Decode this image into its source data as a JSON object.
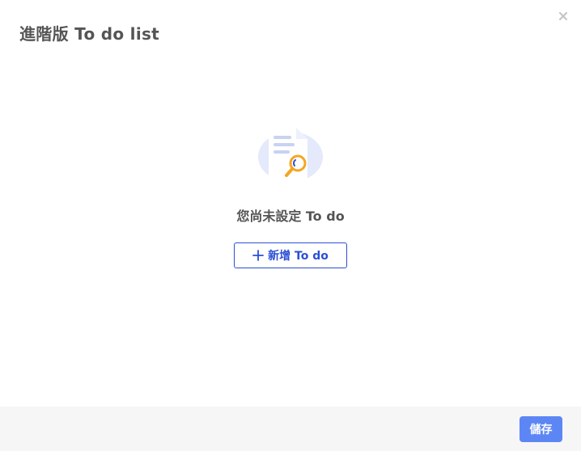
{
  "dialog": {
    "title": "進階版 To do list",
    "close_icon": "close-icon"
  },
  "empty_state": {
    "illustration_icon": "document-search-icon",
    "message": "您尚未設定 To do",
    "add_button_icon": "plus-icon",
    "add_button_label": "新增 To do"
  },
  "footer": {
    "save_label": "儲存"
  },
  "colors": {
    "accent_blue": "#2b4fd6",
    "save_button": "#5d86f5",
    "magnifier_orange": "#f5a623",
    "title_text": "#555555",
    "footer_bg": "#f6f6f7"
  }
}
